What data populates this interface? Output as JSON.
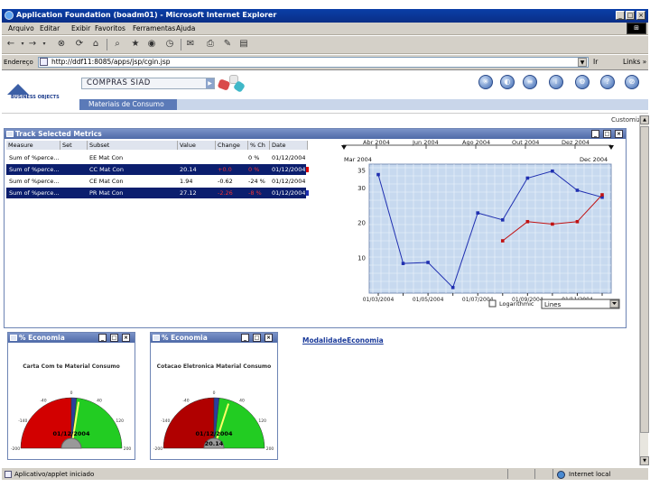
{
  "window": {
    "title": "Application Foundation (boadm01) - Microsoft Internet Explorer",
    "minimize": "_",
    "maximize": "□",
    "close": "×"
  },
  "menu": [
    "Arquivo",
    "Editar",
    "Exibir",
    "Favoritos",
    "Ferramentas",
    "Ajuda"
  ],
  "address": {
    "label": "Endereço",
    "url": "http://ddf11:8085/apps/jsp/cgin.jsp",
    "go": "Ir",
    "links": "Links »"
  },
  "app": {
    "logo_text": "BUSINESS OBJECTS",
    "name": "COMPRAS SIAD",
    "tab": "Materiais de Consumo",
    "customize": "Customize"
  },
  "metrics_panel": {
    "title": "Track Selected Metrics",
    "columns": [
      "Measure",
      "Set",
      "Subset",
      "Value",
      "Change",
      "% Ch",
      "Date"
    ],
    "rows": [
      {
        "measure": "Sum of %perce...",
        "set": "",
        "subset": "EE Mat Con",
        "value": "",
        "change": "",
        "pct": "0 %",
        "date": "01/12/2004",
        "selected": false
      },
      {
        "measure": "Sum of %perce...",
        "set": "",
        "subset": "CC Mat Con",
        "value": "20.14",
        "change": "+0.0",
        "pct": "0 %",
        "date": "01/12/2004",
        "selected": true
      },
      {
        "measure": "Sum of %perce...",
        "set": "",
        "subset": "CE Mat Con",
        "value": "1.94",
        "change": "-0.62",
        "pct": "-24 %",
        "date": "01/12/2004",
        "selected": false
      },
      {
        "measure": "Sum of %perce...",
        "set": "",
        "subset": "PR Mat Con",
        "value": "27.12",
        "change": "-2.26",
        "pct": "-8 %",
        "date": "01/12/2004",
        "selected": true
      }
    ]
  },
  "time_slider": {
    "months": [
      "Abr 2004",
      "Jun 2004",
      "Ago 2004",
      "Out 2004",
      "Dez 2004"
    ],
    "start": "Mar 2004",
    "end": "Dec 2004"
  },
  "chart_controls": {
    "logarithmic": "Logarithmic",
    "type": "Lines"
  },
  "chart_data": {
    "type": "line",
    "x": [
      "01/03/2004",
      "01/04/2004",
      "01/05/2004",
      "01/06/2004",
      "01/07/2004",
      "01/08/2004",
      "01/09/2004",
      "01/10/2004",
      "01/11/2004",
      "01/12/2004"
    ],
    "x_tick_labels": [
      "01/03/2004",
      "01/05/2004",
      "01/07/2004",
      "01/09/2004",
      "01/11/2004"
    ],
    "series": [
      {
        "color": "#1f2fb0",
        "values": [
          34,
          8.5,
          8.8,
          1.6,
          23,
          21,
          33,
          35,
          29.5,
          27.5
        ]
      },
      {
        "color": "#c01010",
        "values": [
          null,
          null,
          null,
          null,
          null,
          15,
          20.5,
          19.8,
          20.5,
          28.2
        ]
      }
    ],
    "ylim": [
      0,
      37
    ],
    "yticks": [
      10,
      20,
      30,
      35
    ],
    "grid": true,
    "title": "",
    "xlabel": "",
    "ylabel": ""
  },
  "gauges": [
    {
      "title": "% Economia",
      "subtitle": "Carta Com te Material Consumo",
      "ticks": [
        "-200",
        "-140",
        "-40",
        "0",
        "40",
        "120",
        "200"
      ],
      "date": "01/12/2004",
      "value_label": "",
      "value": 0.05
    },
    {
      "title": "% Economia",
      "subtitle": "Cotacao Eletronica Material Consumo",
      "ticks": [
        "-200",
        "-140",
        "-40",
        "0",
        "40",
        "120",
        "200"
      ],
      "date": "01/12/2004",
      "value_label": "20.14",
      "value": 0.1
    }
  ],
  "gauge_link": "ModalidadeEconomia",
  "status": {
    "text": "Aplicativo/applet iniciado",
    "zone": "Internet local"
  }
}
